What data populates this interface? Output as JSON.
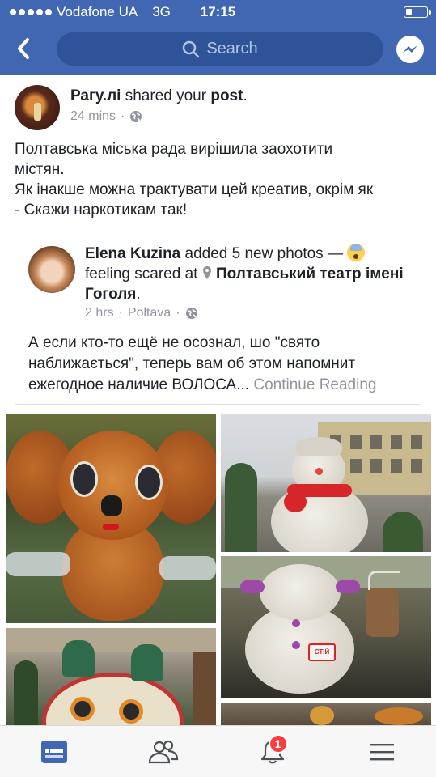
{
  "status_bar": {
    "carrier": "Vodafone UA",
    "network": "3G",
    "time": "17:15"
  },
  "nav": {
    "search_placeholder": "Search"
  },
  "post": {
    "author": "Рагу.лі",
    "action_prefix": " shared your ",
    "action_object": "post",
    "action_suffix": ".",
    "time_ago": "24 mins",
    "text_lines": [
      "Полтавська міська рада вирішила заохотити",
      "містян.",
      "Як інакше можна трактувати цей креатив, окрім як",
      "- Скажи наркотикам так!"
    ]
  },
  "shared_post": {
    "author": "Elena Kuzina",
    "action": " added 5 new photos — ",
    "feeling": "feeling scared at ",
    "place": "Полтавський театр імені Гоголя",
    "place_suffix": ".",
    "time_ago": "2 hrs",
    "location": "Poltava",
    "text": "А если кто-то ещё не осознал, шо \"свято наближається\", теперь вам об этом напомнит ежегодное наличие ВОЛОСА...",
    "continue_label": " Continue Reading",
    "sign_text": "СТІЙ"
  },
  "tabs": [
    {
      "name": "news-feed",
      "icon": "news-feed-icon"
    },
    {
      "name": "friend-requests",
      "icon": "friends-icon"
    },
    {
      "name": "notifications",
      "icon": "bell-icon",
      "badge": "1"
    },
    {
      "name": "menu",
      "icon": "hamburger-icon"
    }
  ],
  "colors": {
    "brand": "#4267b2",
    "search_bg": "#2f5399",
    "badge": "#fa3e3e",
    "meta_text": "#90949c"
  }
}
